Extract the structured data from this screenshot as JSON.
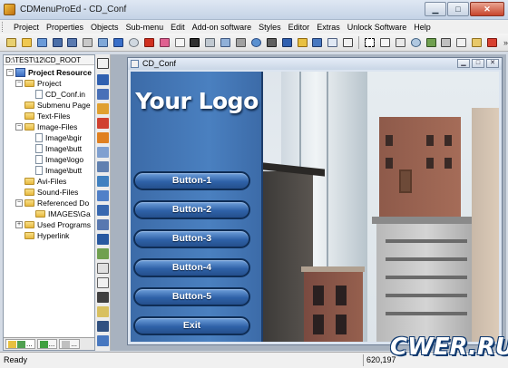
{
  "window": {
    "title": "CDMenuProEd - CD_Conf"
  },
  "menubar": [
    "Project",
    "Properties",
    "Objects",
    "Sub-menu",
    "Edit",
    "Add-on software",
    "Styles",
    "Editor",
    "Extras",
    "Unlock Software",
    "Help"
  ],
  "toolbar": {
    "more_label": "»"
  },
  "left_panel": {
    "path": "D:\\TEST\\12\\CD_ROOT",
    "tree": [
      {
        "label": "Project Resource",
        "level": 0,
        "icon": "project",
        "expander": "−",
        "bold": true
      },
      {
        "label": "Project",
        "level": 1,
        "icon": "folder",
        "expander": "−"
      },
      {
        "label": "CD_Conf.in",
        "level": 2,
        "icon": "doc",
        "expander": ""
      },
      {
        "label": "Submenu Page",
        "level": 1,
        "icon": "folder",
        "expander": ""
      },
      {
        "label": "Text-Files",
        "level": 1,
        "icon": "folder",
        "expander": ""
      },
      {
        "label": "Image-Files",
        "level": 1,
        "icon": "folder",
        "expander": "−"
      },
      {
        "label": "Image\\bgir",
        "level": 2,
        "icon": "doc",
        "expander": ""
      },
      {
        "label": "Image\\butt",
        "level": 2,
        "icon": "doc",
        "expander": ""
      },
      {
        "label": "Image\\logo",
        "level": 2,
        "icon": "doc",
        "expander": ""
      },
      {
        "label": "Image\\butt",
        "level": 2,
        "icon": "doc",
        "expander": ""
      },
      {
        "label": "Avi-Files",
        "level": 1,
        "icon": "folder",
        "expander": ""
      },
      {
        "label": "Sound-Files",
        "level": 1,
        "icon": "folder",
        "expander": ""
      },
      {
        "label": "Referenced Do",
        "level": 1,
        "icon": "folder",
        "expander": "−"
      },
      {
        "label": "IMAGES\\Ga",
        "level": 2,
        "icon": "folder",
        "expander": ""
      },
      {
        "label": "Used Programs",
        "level": 1,
        "icon": "folder",
        "expander": "+"
      },
      {
        "label": "Hyperlink",
        "level": 1,
        "icon": "folder",
        "expander": ""
      }
    ],
    "tabs": [
      "...",
      "...",
      "..."
    ]
  },
  "child_window": {
    "title": "CD_Conf",
    "min": "▁",
    "max": "□",
    "close": "✕"
  },
  "cd_menu": {
    "logo": "Your Logo",
    "buttons": [
      "Button-1",
      "Button-2",
      "Button-3",
      "Button-4",
      "Button-5",
      "Exit"
    ]
  },
  "statusbar": {
    "status": "Ready",
    "coords": "620,197"
  },
  "watermark": "CWER.RU"
}
